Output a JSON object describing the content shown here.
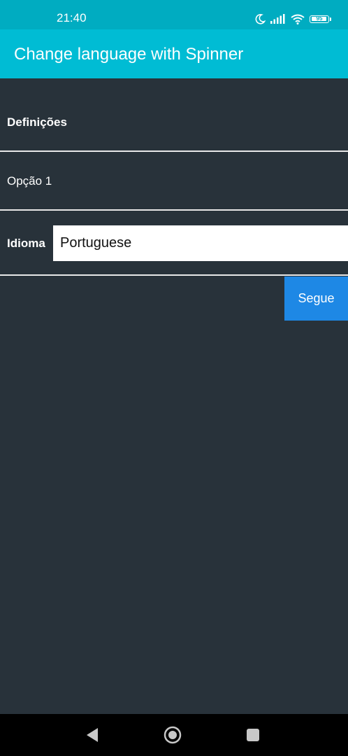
{
  "status_bar": {
    "time": "21:40",
    "icons": [
      "moon-icon",
      "signal-icon",
      "wifi-icon",
      "battery-icon"
    ],
    "battery_level": "95"
  },
  "app_bar": {
    "title": "Change language with Spinner",
    "color": "#00bcd4"
  },
  "settings": {
    "header": "Definições",
    "option_1": "Opção 1",
    "language_label": "Idioma",
    "language_value": "Portuguese"
  },
  "actions": {
    "next_label": "Segue",
    "accent_color": "#1e88e5"
  },
  "nav_bar": {
    "icons": [
      "back-icon",
      "home-icon",
      "recents-icon"
    ]
  },
  "colors": {
    "background": "#28323a",
    "status_bar": "#00acc1"
  }
}
